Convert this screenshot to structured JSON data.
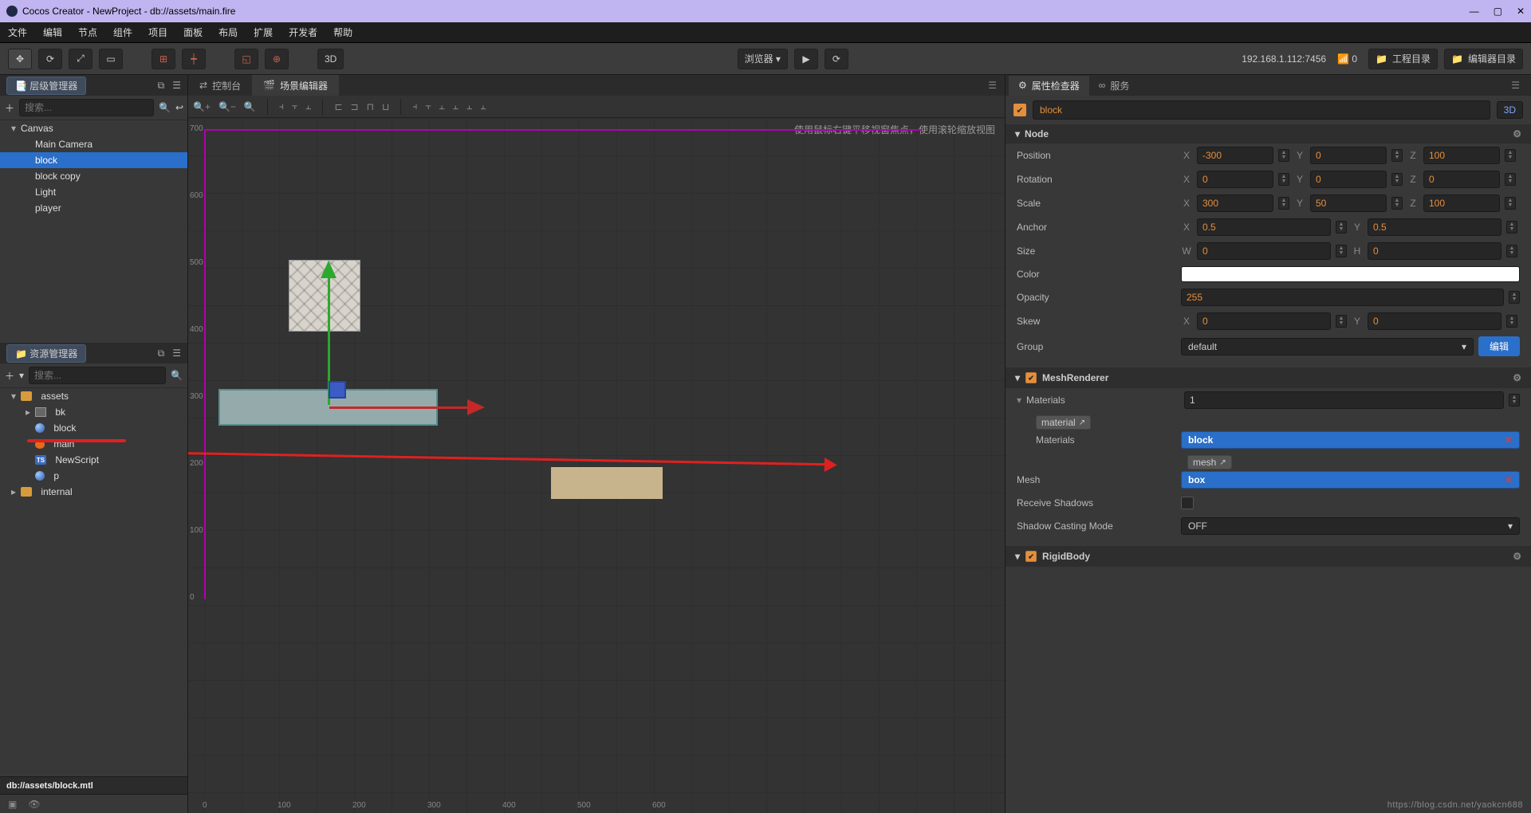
{
  "window": {
    "title": "Cocos Creator - NewProject - db://assets/main.fire"
  },
  "menubar": [
    "文件",
    "编辑",
    "节点",
    "组件",
    "项目",
    "面板",
    "布局",
    "扩展",
    "开发者",
    "帮助"
  ],
  "toolbar": {
    "btn_3d": "3D",
    "preview_label": "浏览器 ▾",
    "ip": "192.168.1.112:7456",
    "wifi": "0",
    "proj_dir": "工程目录",
    "editor_dir": "编辑器目录"
  },
  "hierarchy": {
    "tab": "层级管理器",
    "search_ph": "搜索...",
    "items": [
      {
        "label": "Canvas",
        "depth": 0,
        "sel": false,
        "caret": "▾"
      },
      {
        "label": "Main Camera",
        "depth": 1,
        "sel": false
      },
      {
        "label": "block",
        "depth": 1,
        "sel": true
      },
      {
        "label": "block copy",
        "depth": 1,
        "sel": false
      },
      {
        "label": "Light",
        "depth": 1,
        "sel": false
      },
      {
        "label": "player",
        "depth": 1,
        "sel": false
      }
    ]
  },
  "assets": {
    "tab": "资源管理器",
    "search_ph": "搜索...",
    "items": [
      {
        "label": "assets",
        "depth": 0,
        "icon": "folder",
        "caret": "▾"
      },
      {
        "label": "bk",
        "depth": 1,
        "icon": "img",
        "caret": "▸"
      },
      {
        "label": "block",
        "depth": 1,
        "icon": "sphere"
      },
      {
        "label": "main",
        "depth": 1,
        "icon": "flame"
      },
      {
        "label": "NewScript",
        "depth": 1,
        "icon": "ts"
      },
      {
        "label": "p",
        "depth": 1,
        "icon": "sphere"
      },
      {
        "label": "internal",
        "depth": 0,
        "icon": "folder",
        "caret": "▸"
      }
    ],
    "status": "db://assets/block.mtl"
  },
  "scene": {
    "console_tab": "控制台",
    "editor_tab": "场景编辑器",
    "hint": "使用鼠标右键平移视窗焦点，使用滚轮缩放视图",
    "y_ticks": [
      "700",
      "600",
      "500",
      "400",
      "300",
      "200",
      "100",
      "0"
    ],
    "x_ticks": [
      "0",
      "100",
      "200",
      "300",
      "400",
      "500",
      "600"
    ]
  },
  "inspector": {
    "tab_props": "属性检查器",
    "tab_services": "服务",
    "node_name": "block",
    "btn_3d": "3D",
    "node": {
      "header": "Node",
      "position": {
        "label": "Position",
        "x": "-300",
        "y": "0",
        "z": "100"
      },
      "rotation": {
        "label": "Rotation",
        "x": "0",
        "y": "0",
        "z": "0"
      },
      "scale": {
        "label": "Scale",
        "x": "300",
        "y": "50",
        "z": "100"
      },
      "anchor": {
        "label": "Anchor",
        "x": "0.5",
        "y": "0.5"
      },
      "size": {
        "label": "Size",
        "w": "0",
        "h": "0"
      },
      "color": {
        "label": "Color"
      },
      "opacity": {
        "label": "Opacity",
        "val": "255"
      },
      "skew": {
        "label": "Skew",
        "x": "0",
        "y": "0"
      },
      "group": {
        "label": "Group",
        "val": "default",
        "edit": "编辑"
      }
    },
    "mesh": {
      "header": "MeshRenderer",
      "materials_label": "Materials",
      "count": "1",
      "material_chip": "material",
      "material_val": "block",
      "mesh_label": "Mesh",
      "mesh_chip": "mesh",
      "mesh_val": "box",
      "recv_shadows": "Receive Shadows",
      "cast_mode": "Shadow Casting Mode",
      "cast_val": "OFF"
    },
    "rigid": {
      "header": "RigidBody"
    }
  },
  "watermark": "https://blog.csdn.net/yaokcn688"
}
